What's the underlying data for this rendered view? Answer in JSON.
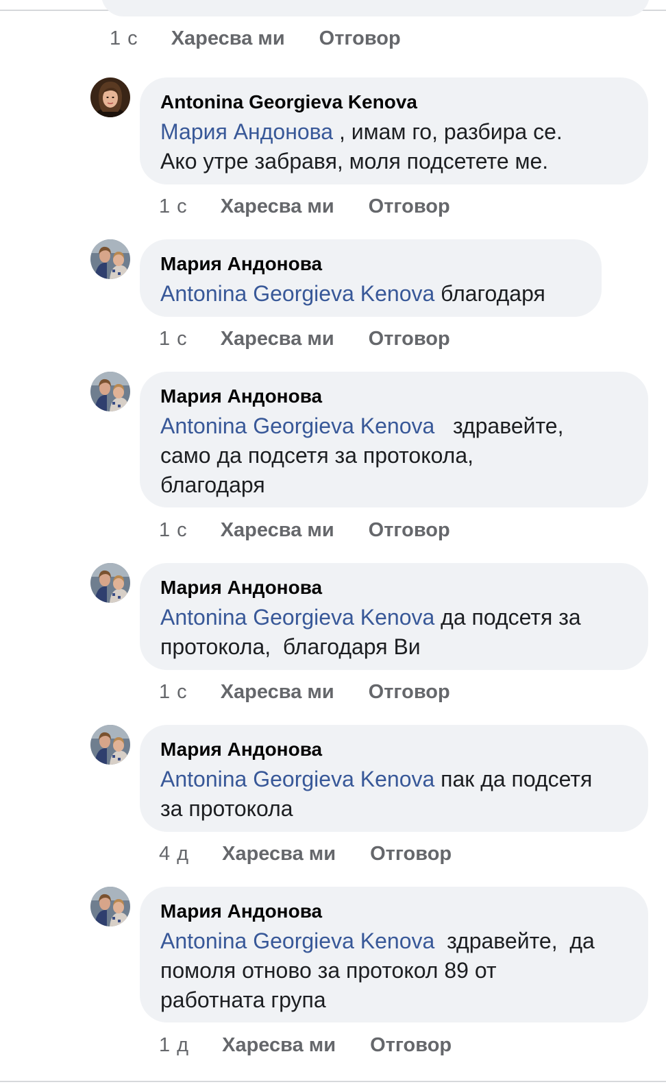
{
  "top_actions": {
    "time": "1 с",
    "like": "Харесва ми",
    "reply": "Отговор"
  },
  "comments": [
    {
      "author": "Antonina Georgieva Kenova",
      "mention": "Мария Андонова",
      "text": ", имам го, разбира се.",
      "text2": "Ако утре забравя, моля подсетете ме.",
      "time": "1 с",
      "like": "Харесва ми",
      "reply": "Отговор"
    },
    {
      "author": "Мария Андонова",
      "mention": "Antonina Georgieva Kenova",
      "text": "благодаря",
      "time": "1 с",
      "like": "Харесва ми",
      "reply": "Отговор"
    },
    {
      "author": "Мария Андонова",
      "mention": "Antonina Georgieva Kenova",
      "text": "здравейте,",
      "text2": "само да подсетя за протокола,",
      "text3": "благодаря",
      "time": "1 с",
      "like": "Харесва ми",
      "reply": "Отговор"
    },
    {
      "author": "Мария Андонова",
      "mention": "Antonina Georgieva Kenova",
      "text": "да подсетя за",
      "text2": "протокола,  благодаря Ви",
      "time": "1 с",
      "like": "Харесва ми",
      "reply": "Отговор"
    },
    {
      "author": "Мария Андонова",
      "mention": "Antonina Georgieva Kenova",
      "text": "пак да подсетя",
      "text2": "за протокола",
      "time": "4 д",
      "like": "Харесва ми",
      "reply": "Отговор"
    },
    {
      "author": "Мария Андонова",
      "mention": "Antonina Georgieva Kenova",
      "text": "здравейте,  да",
      "text2": "помоля отново за протокол 89 от",
      "text3": "работната група",
      "time": "1 д",
      "like": "Харесва ми",
      "reply": "Отговор"
    }
  ],
  "colors": {
    "bubble": "#f0f2f5",
    "mention": "#385898",
    "meta": "#65676b"
  }
}
